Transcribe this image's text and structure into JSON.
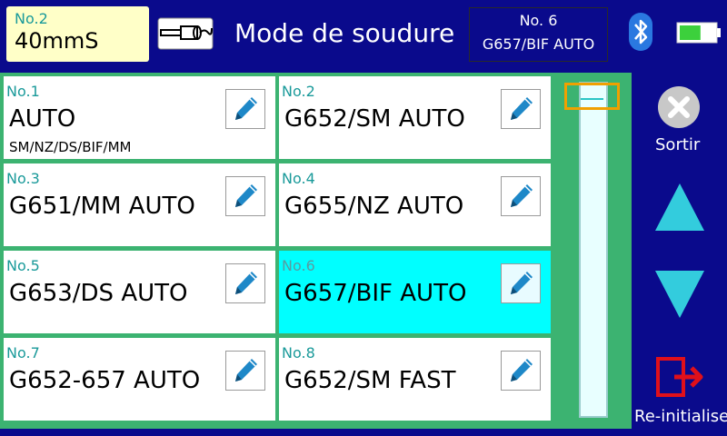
{
  "header": {
    "program_label": "No.2",
    "program_value": "40mmS",
    "title": "Mode de soudure",
    "current_mode_number": "No. 6",
    "current_mode_name": "G657/BIF AUTO"
  },
  "icons": {
    "fiber": "fiber-holder-icon",
    "bluetooth": "bluetooth-icon",
    "battery": "battery-icon",
    "exit": "close-icon",
    "up": "arrow-up-icon",
    "down": "arrow-down-icon",
    "reset": "exit-door-icon",
    "edit": "pencil-icon"
  },
  "battery_level": 0.6,
  "modes": [
    {
      "number": "No.1",
      "name": "AUTO",
      "desc": "SM/NZ/DS/BIF/MM",
      "selected": false
    },
    {
      "number": "No.2",
      "name": "G652/SM AUTO",
      "desc": "",
      "selected": false
    },
    {
      "number": "No.3",
      "name": "G651/MM AUTO",
      "desc": "",
      "selected": false
    },
    {
      "number": "No.4",
      "name": "G655/NZ AUTO",
      "desc": "",
      "selected": false
    },
    {
      "number": "No.5",
      "name": "G653/DS AUTO",
      "desc": "",
      "selected": false
    },
    {
      "number": "No.6",
      "name": "G657/BIF AUTO",
      "desc": "",
      "selected": true
    },
    {
      "number": "No.7",
      "name": "G652-657 AUTO",
      "desc": "",
      "selected": false
    },
    {
      "number": "No.8",
      "name": "G652/SM FAST",
      "desc": "",
      "selected": false
    }
  ],
  "sidebar": {
    "exit_label": "Sortir",
    "reset_label": "Re-initialise"
  },
  "colors": {
    "background": "#0a0a8c",
    "panel": "#3cb371",
    "selected": "#00ffff",
    "accent_cyan": "#33ccdd",
    "pencil": "#1e88c8",
    "scroll_highlight": "#f0a000",
    "reset_red": "#e0101a"
  }
}
